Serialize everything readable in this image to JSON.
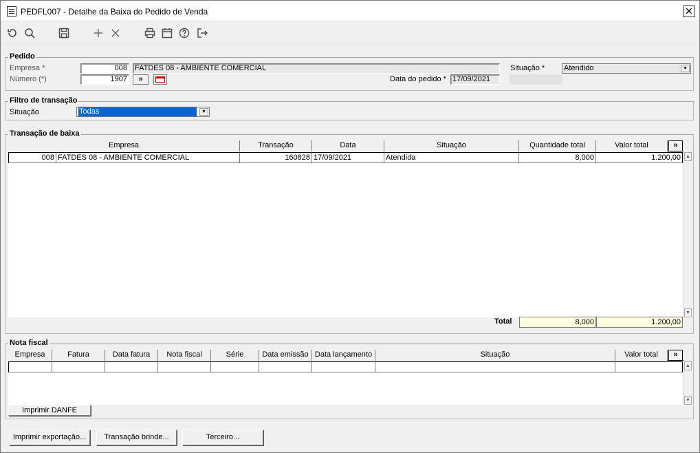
{
  "window": {
    "title": "PEDFL007 - Detalhe da Baixa do Pedido de Venda"
  },
  "toolbar": {
    "icons": [
      "refresh-icon",
      "search-icon",
      "save-icon",
      "add-icon",
      "delete-icon",
      "print-icon",
      "calendar-icon",
      "help-icon",
      "exit-icon"
    ]
  },
  "pedido": {
    "legend": "Pedido",
    "empresa_label": "Empresa *",
    "empresa_code": "008",
    "empresa_name": "FATDES 08 - AMBIENTE COMERCIAL",
    "numero_label": "Número (*)",
    "numero_value": "1907",
    "search_button": "»",
    "data_label": "Data do pedido *",
    "data_value": "17/09/2021",
    "situacao_label": "Situação *",
    "situacao_value": "Atendido"
  },
  "filtro": {
    "legend": "Filtro de transação",
    "situacao_label": "Situação",
    "situacao_value": "Todas"
  },
  "transacao": {
    "legend": "Transação de baixa",
    "columns": [
      "Empresa",
      "Transação",
      "Data",
      "Situação",
      "Quantidade total",
      "Valor total"
    ],
    "more_button": "»",
    "rows": [
      {
        "empresa_code": "008",
        "empresa_name": "FATDES 08 - AMBIENTE COMERCIAL",
        "transacao": "160828",
        "data": "17/09/2021",
        "situacao": "Atendida",
        "quantidade": "8,000",
        "valor": "1.200,00"
      }
    ],
    "total_label": "Total",
    "total_quantidade": "8,000",
    "total_valor": "1.200,00"
  },
  "nota": {
    "legend": "Nota fiscal",
    "columns": [
      "Empresa",
      "Fatura",
      "Data fatura",
      "Nota fiscal",
      "Série",
      "Data emissão",
      "Data lançamento",
      "Situação",
      "Valor total"
    ],
    "more_button": "»",
    "imprimir_danfe": "Imprimir DANFE"
  },
  "footer": {
    "imprimir_exportacao": "Imprimir exportação...",
    "transacao_brinde": "Transação brinde...",
    "terceiro": "Terceiro..."
  }
}
